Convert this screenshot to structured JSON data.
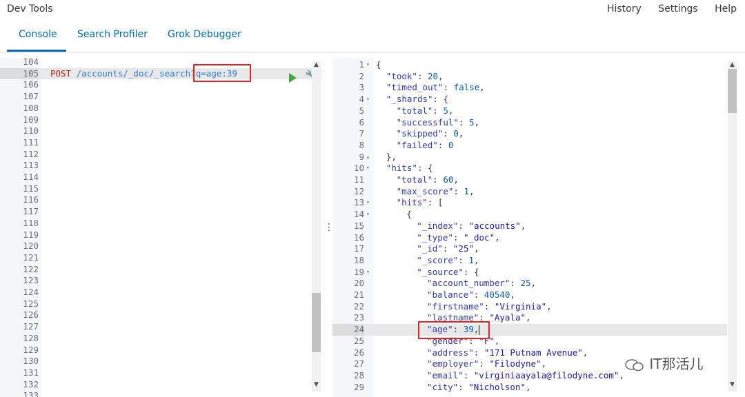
{
  "header": {
    "title": "Dev Tools",
    "links": [
      "History",
      "Settings",
      "Help"
    ]
  },
  "tabs": [
    "Console",
    "Search Profiler",
    "Grok Debugger"
  ],
  "editor": {
    "first_line_number": 104,
    "line_numbers": [
      "104",
      "105",
      "106",
      "107",
      "108",
      "109",
      "110",
      "111",
      "112",
      "113",
      "114",
      "115",
      "116",
      "117",
      "118",
      "119",
      "120",
      "121",
      "122",
      "123",
      "124",
      "125",
      "126",
      "127",
      "128",
      "129",
      "130",
      "131",
      "132",
      "133"
    ],
    "active_line": "105",
    "request_method": "POST",
    "request_path": "/accounts/_doc/_search",
    "request_query": "?q=age:39"
  },
  "output": {
    "active_line": "24",
    "lines": [
      {
        "n": "1",
        "fold": "▾",
        "segs": [
          [
            "p",
            "{"
          ]
        ],
        "indent": 0
      },
      {
        "n": "2",
        "segs": [
          [
            "k",
            "\"took\""
          ],
          [
            "p",
            ": "
          ],
          [
            "n",
            "20"
          ],
          [
            "p",
            ","
          ]
        ],
        "indent": 1
      },
      {
        "n": "3",
        "segs": [
          [
            "k",
            "\"timed_out\""
          ],
          [
            "p",
            ": "
          ],
          [
            "n",
            "false"
          ],
          [
            "p",
            ","
          ]
        ],
        "indent": 1
      },
      {
        "n": "4",
        "fold": "▾",
        "segs": [
          [
            "k",
            "\"_shards\""
          ],
          [
            "p",
            ": {"
          ]
        ],
        "indent": 1
      },
      {
        "n": "5",
        "segs": [
          [
            "k",
            "\"total\""
          ],
          [
            "p",
            ": "
          ],
          [
            "n",
            "5"
          ],
          [
            "p",
            ","
          ]
        ],
        "indent": 2
      },
      {
        "n": "6",
        "segs": [
          [
            "k",
            "\"successful\""
          ],
          [
            "p",
            ": "
          ],
          [
            "n",
            "5"
          ],
          [
            "p",
            ","
          ]
        ],
        "indent": 2
      },
      {
        "n": "7",
        "segs": [
          [
            "k",
            "\"skipped\""
          ],
          [
            "p",
            ": "
          ],
          [
            "n",
            "0"
          ],
          [
            "p",
            ","
          ]
        ],
        "indent": 2
      },
      {
        "n": "8",
        "segs": [
          [
            "k",
            "\"failed\""
          ],
          [
            "p",
            ": "
          ],
          [
            "n",
            "0"
          ]
        ],
        "indent": 2
      },
      {
        "n": "9",
        "fold": "▴",
        "segs": [
          [
            "p",
            "},"
          ]
        ],
        "indent": 1
      },
      {
        "n": "10",
        "fold": "▾",
        "segs": [
          [
            "k",
            "\"hits\""
          ],
          [
            "p",
            ": {"
          ]
        ],
        "indent": 1
      },
      {
        "n": "11",
        "segs": [
          [
            "k",
            "\"total\""
          ],
          [
            "p",
            ": "
          ],
          [
            "n",
            "60"
          ],
          [
            "p",
            ","
          ]
        ],
        "indent": 2
      },
      {
        "n": "12",
        "segs": [
          [
            "k",
            "\"max_score\""
          ],
          [
            "p",
            ": "
          ],
          [
            "n",
            "1"
          ],
          [
            "p",
            ","
          ]
        ],
        "indent": 2
      },
      {
        "n": "13",
        "fold": "▾",
        "segs": [
          [
            "k",
            "\"hits\""
          ],
          [
            "p",
            ": ["
          ]
        ],
        "indent": 2
      },
      {
        "n": "14",
        "fold": "▾",
        "segs": [
          [
            "p",
            "{"
          ]
        ],
        "indent": 3
      },
      {
        "n": "15",
        "segs": [
          [
            "k",
            "\"_index\""
          ],
          [
            "p",
            ": "
          ],
          [
            "s",
            "\"accounts\""
          ],
          [
            "p",
            ","
          ]
        ],
        "indent": 4
      },
      {
        "n": "16",
        "segs": [
          [
            "k",
            "\"_type\""
          ],
          [
            "p",
            ": "
          ],
          [
            "s",
            "\"_doc\""
          ],
          [
            "p",
            ","
          ]
        ],
        "indent": 4
      },
      {
        "n": "17",
        "segs": [
          [
            "k",
            "\"_id\""
          ],
          [
            "p",
            ": "
          ],
          [
            "s",
            "\"25\""
          ],
          [
            "p",
            ","
          ]
        ],
        "indent": 4
      },
      {
        "n": "18",
        "segs": [
          [
            "k",
            "\"_score\""
          ],
          [
            "p",
            ": "
          ],
          [
            "n",
            "1"
          ],
          [
            "p",
            ","
          ]
        ],
        "indent": 4
      },
      {
        "n": "19",
        "fold": "▾",
        "segs": [
          [
            "k",
            "\"_source\""
          ],
          [
            "p",
            ": {"
          ]
        ],
        "indent": 4
      },
      {
        "n": "20",
        "segs": [
          [
            "k",
            "\"account_number\""
          ],
          [
            "p",
            ": "
          ],
          [
            "n",
            "25"
          ],
          [
            "p",
            ","
          ]
        ],
        "indent": 5
      },
      {
        "n": "21",
        "segs": [
          [
            "k",
            "\"balance\""
          ],
          [
            "p",
            ": "
          ],
          [
            "n",
            "40540"
          ],
          [
            "p",
            ","
          ]
        ],
        "indent": 5
      },
      {
        "n": "22",
        "segs": [
          [
            "k",
            "\"firstname\""
          ],
          [
            "p",
            ": "
          ],
          [
            "s",
            "\"Virginia\""
          ],
          [
            "p",
            ","
          ]
        ],
        "indent": 5
      },
      {
        "n": "23",
        "segs": [
          [
            "k",
            "\"lastname\""
          ],
          [
            "p",
            ": "
          ],
          [
            "s",
            "\"Ayala\""
          ],
          [
            "p",
            ","
          ]
        ],
        "indent": 5
      },
      {
        "n": "24",
        "segs": [
          [
            "k",
            "\"age\""
          ],
          [
            "p",
            ": "
          ],
          [
            "n",
            "39"
          ],
          [
            "p",
            ","
          ]
        ],
        "indent": 5
      },
      {
        "n": "25",
        "segs": [
          [
            "k",
            "\"gender\""
          ],
          [
            "p",
            ": "
          ],
          [
            "s",
            "\"F\""
          ],
          [
            "p",
            ","
          ]
        ],
        "indent": 5
      },
      {
        "n": "26",
        "segs": [
          [
            "k",
            "\"address\""
          ],
          [
            "p",
            ": "
          ],
          [
            "s",
            "\"171 Putnam Avenue\""
          ],
          [
            "p",
            ","
          ]
        ],
        "indent": 5
      },
      {
        "n": "27",
        "segs": [
          [
            "k",
            "\"employer\""
          ],
          [
            "p",
            ": "
          ],
          [
            "s",
            "\"Filodyne\""
          ],
          [
            "p",
            ","
          ]
        ],
        "indent": 5
      },
      {
        "n": "28",
        "segs": [
          [
            "k",
            "\"email\""
          ],
          [
            "p",
            ": "
          ],
          [
            "s",
            "\"virginiaayala@filodyne.com\""
          ],
          [
            "p",
            ","
          ]
        ],
        "indent": 5
      },
      {
        "n": "29",
        "segs": [
          [
            "k",
            "\"city\""
          ],
          [
            "p",
            ": "
          ],
          [
            "s",
            "\"Nicholson\""
          ],
          [
            "p",
            ","
          ]
        ],
        "indent": 5
      }
    ]
  },
  "watermark": "IT那活儿",
  "colors": {
    "accent": "#006bb4",
    "highlight_box": "#e02424",
    "run": "#3eab3e"
  }
}
